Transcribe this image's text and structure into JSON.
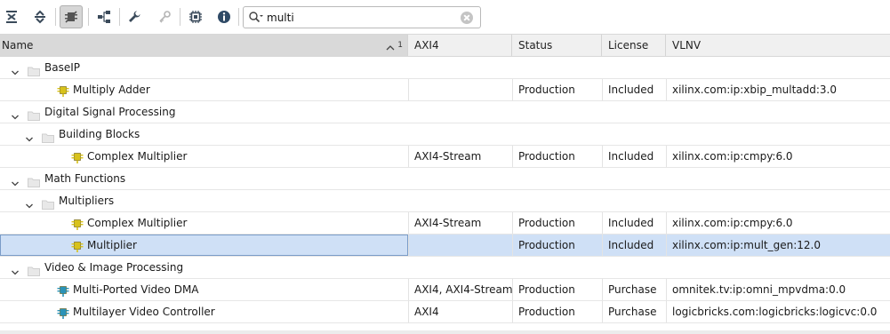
{
  "toolbar": {
    "buttons": [
      {
        "icon": "collapse-all-icon"
      },
      {
        "icon": "expand-all-icon"
      },
      {
        "icon": "filter-compatible-icon",
        "active": true
      },
      {
        "icon": "hierarchy-icon"
      },
      {
        "icon": "wrench-icon"
      },
      {
        "icon": "key-icon"
      },
      {
        "icon": "chip-icon"
      },
      {
        "icon": "info-icon"
      }
    ],
    "search_value": "multi"
  },
  "table": {
    "columns": [
      "Name",
      "AXI4",
      "Status",
      "License",
      "VLNV"
    ],
    "sort_indicator": "1",
    "rows": [
      {
        "type": "category",
        "level": 0,
        "name": "BaseIP"
      },
      {
        "type": "ip",
        "level": 1,
        "name": "Multiply Adder",
        "axi": "",
        "status": "Production",
        "license": "Included",
        "vlnv": "xilinx.com:ip:xbip_multadd:3.0",
        "icon_color": "yellow"
      },
      {
        "type": "category",
        "level": 0,
        "name": "Digital Signal Processing"
      },
      {
        "type": "category",
        "level": 1,
        "name": "Building Blocks"
      },
      {
        "type": "ip",
        "level": 2,
        "name": "Complex Multiplier",
        "axi": "AXI4-Stream",
        "status": "Production",
        "license": "Included",
        "vlnv": "xilinx.com:ip:cmpy:6.0",
        "icon_color": "yellow"
      },
      {
        "type": "category",
        "level": 0,
        "name": "Math Functions"
      },
      {
        "type": "category",
        "level": 1,
        "name": "Multipliers"
      },
      {
        "type": "ip",
        "level": 2,
        "name": "Complex Multiplier",
        "axi": "AXI4-Stream",
        "status": "Production",
        "license": "Included",
        "vlnv": "xilinx.com:ip:cmpy:6.0",
        "icon_color": "yellow"
      },
      {
        "type": "ip",
        "level": 2,
        "name": "Multiplier",
        "axi": "",
        "status": "Production",
        "license": "Included",
        "vlnv": "xilinx.com:ip:mult_gen:12.0",
        "icon_color": "yellow",
        "selected": true
      },
      {
        "type": "category",
        "level": 0,
        "name": "Video & Image Processing"
      },
      {
        "type": "ip",
        "level": 1,
        "name": "Multi-Ported Video DMA",
        "axi": "AXI4, AXI4-Stream",
        "status": "Production",
        "license": "Purchase",
        "vlnv": "omnitek.tv:ip:omni_mpvdma:0.0",
        "icon_color": "teal"
      },
      {
        "type": "ip",
        "level": 1,
        "name": "Multilayer Video Controller",
        "axi": "AXI4",
        "status": "Production",
        "license": "Purchase",
        "vlnv": "logicbricks.com:logicbricks:logicvc:0.0",
        "icon_color": "teal"
      }
    ]
  },
  "colors": {
    "selection": "#cfe0f6",
    "ip_yellow": "#d8c21a",
    "ip_teal": "#2a93b8",
    "folder": "#cfcfcf"
  }
}
